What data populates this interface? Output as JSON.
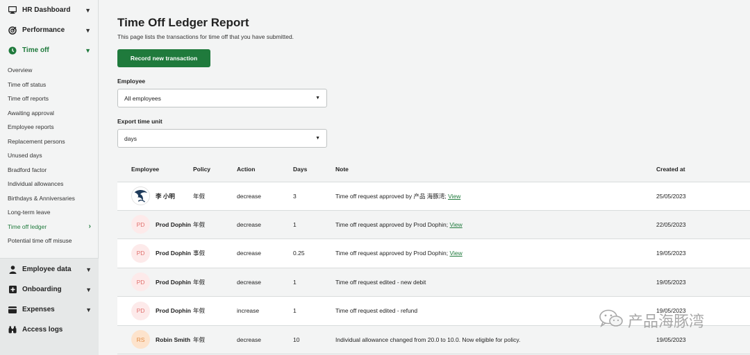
{
  "sidebar": {
    "top": [
      {
        "label": "HR Dashboard",
        "icon": "monitor-icon"
      },
      {
        "label": "Performance",
        "icon": "target-icon"
      }
    ],
    "time_off": {
      "label": "Time off",
      "icon": "clock-icon",
      "items": [
        "Overview",
        "Time off status",
        "Time off reports",
        "Awaiting approval",
        "Employee reports",
        "Replacement persons",
        "Unused days",
        "Bradford factor",
        "Individual allowances",
        "Birthdays & Anniversaries",
        "Long-term leave",
        "Time off ledger",
        "Potential time off misuse"
      ]
    },
    "lower": [
      {
        "label": "Employee data",
        "icon": "person-icon"
      },
      {
        "label": "Onboarding",
        "icon": "plus-square-icon"
      },
      {
        "label": "Expenses",
        "icon": "wallet-icon"
      },
      {
        "label": "Access logs",
        "icon": "binoculars-icon"
      }
    ]
  },
  "page": {
    "title": "Time Off Ledger Report",
    "description": "This page lists the transactions for time off that you have submitted.",
    "record_button": "Record new transaction"
  },
  "filters": {
    "employee_label": "Employee",
    "employee_value": "All employees",
    "unit_label": "Export time unit",
    "unit_value": "days"
  },
  "table": {
    "headers": {
      "employee": "Employee",
      "policy": "Policy",
      "action": "Action",
      "days": "Days",
      "note": "Note",
      "created": "Created at"
    },
    "rows": [
      {
        "initials": "",
        "name": "李 小明",
        "policy": "年假",
        "action": "decrease",
        "days": "3",
        "note": "Time off request approved by 产品 海豚湾;",
        "link": "View",
        "created": "25/05/2023"
      },
      {
        "initials": "PD",
        "name": "Prod Dophin",
        "policy": "年假",
        "action": "decrease",
        "days": "1",
        "note": "Time off request approved by Prod Dophin;",
        "link": "View",
        "created": "22/05/2023"
      },
      {
        "initials": "PD",
        "name": "Prod Dophin",
        "policy": "事假",
        "action": "decrease",
        "days": "0.25",
        "note": "Time off request approved by Prod Dophin;",
        "link": "View",
        "created": "19/05/2023"
      },
      {
        "initials": "PD",
        "name": "Prod Dophin",
        "policy": "年假",
        "action": "decrease",
        "days": "1",
        "note": "Time off request edited - new debit",
        "link": "",
        "created": "19/05/2023"
      },
      {
        "initials": "PD",
        "name": "Prod Dophin",
        "policy": "年假",
        "action": "increase",
        "days": "1",
        "note": "Time off request edited - refund",
        "link": "",
        "created": "19/05/2023"
      },
      {
        "initials": "RS",
        "name": "Robin Smith",
        "policy": "年假",
        "action": "decrease",
        "days": "10",
        "note": "Individual allowance changed from 20.0 to 10.0. Now eligible for policy.",
        "link": "",
        "created": "19/05/2023"
      }
    ]
  },
  "watermark": "产品海豚湾",
  "colors": {
    "accent": "#1f7a3c",
    "sidebar_bg": "#f3f4f4",
    "lower_sidebar_bg": "#e6e8e8"
  }
}
